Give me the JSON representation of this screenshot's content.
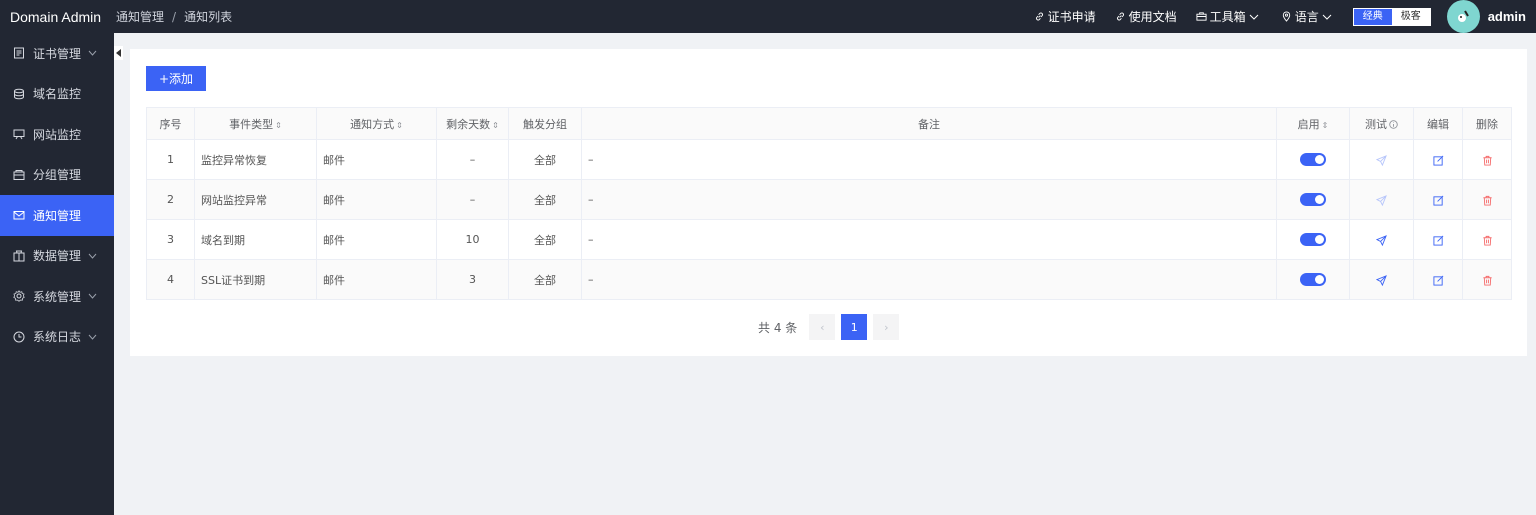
{
  "app": {
    "brand": "Domain Admin"
  },
  "breadcrumb": [
    "通知管理",
    "/",
    "通知列表"
  ],
  "header": {
    "links": [
      {
        "label": "证书申请",
        "icon": "link-icon"
      },
      {
        "label": "使用文档",
        "icon": "link-icon"
      },
      {
        "label": "工具箱",
        "icon": "briefcase-icon",
        "has_dropdown": true
      },
      {
        "label": "语言",
        "icon": "location-icon",
        "has_dropdown": true
      }
    ],
    "mode": {
      "classic": "经典",
      "geek": "极客",
      "active": "classic"
    },
    "username": "admin"
  },
  "sidebar": {
    "items": [
      {
        "label": "证书管理",
        "icon": "document-icon",
        "expandable": true
      },
      {
        "label": "域名监控",
        "icon": "database-icon",
        "expandable": false
      },
      {
        "label": "网站监控",
        "icon": "monitor-icon",
        "expandable": false
      },
      {
        "label": "分组管理",
        "icon": "box-icon",
        "expandable": false
      },
      {
        "label": "通知管理",
        "icon": "mail-icon",
        "expandable": false,
        "active": true
      },
      {
        "label": "数据管理",
        "icon": "gift-icon",
        "expandable": true
      },
      {
        "label": "系统管理",
        "icon": "gear-icon",
        "expandable": true
      },
      {
        "label": "系统日志",
        "icon": "clock-icon",
        "expandable": true
      }
    ]
  },
  "toolbar": {
    "add_label": "+添加"
  },
  "table": {
    "columns": [
      "序号",
      "事件类型",
      "通知方式",
      "剩余天数",
      "触发分组",
      "备注",
      "启用",
      "测试",
      "编辑",
      "删除"
    ],
    "rows": [
      {
        "index": "1",
        "event": "监控异常恢复",
        "method": "邮件",
        "days": "–",
        "group": "全部",
        "note": "–",
        "enabled": true,
        "test_active": false
      },
      {
        "index": "2",
        "event": "网站监控异常",
        "method": "邮件",
        "days": "–",
        "group": "全部",
        "note": "–",
        "enabled": true,
        "test_active": false
      },
      {
        "index": "3",
        "event": "域名到期",
        "method": "邮件",
        "days": "10",
        "group": "全部",
        "note": "–",
        "enabled": true,
        "test_active": true
      },
      {
        "index": "4",
        "event": "SSL证书到期",
        "method": "邮件",
        "days": "3",
        "group": "全部",
        "note": "–",
        "enabled": true,
        "test_active": true
      }
    ]
  },
  "pagination": {
    "total_text": "共 4 条",
    "current": "1",
    "prev": "‹",
    "next": "›"
  },
  "colors": {
    "accent": "#3b63f5",
    "header_bg": "#222733",
    "danger": "#f56c6c"
  }
}
